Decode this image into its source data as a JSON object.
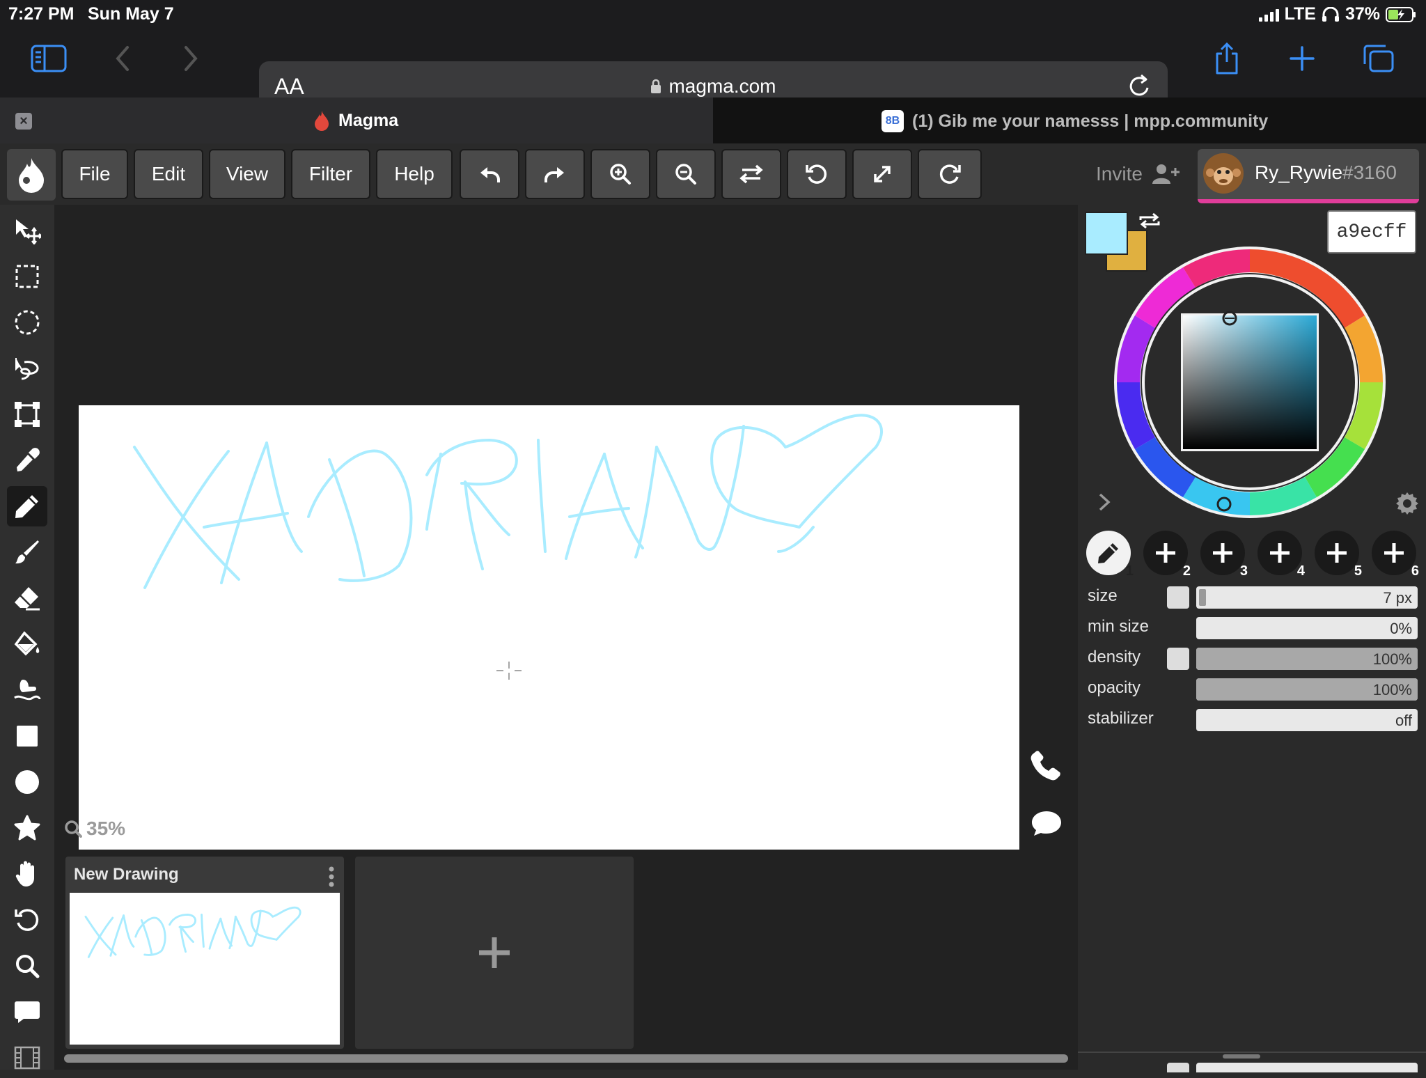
{
  "status": {
    "time": "7:27 PM",
    "date": "Sun May 7",
    "network": "LTE",
    "battery": "37%"
  },
  "browser": {
    "aa_label": "AA",
    "url": "magma.com"
  },
  "tabs": [
    {
      "title": "Magma",
      "active": true
    },
    {
      "title": "(1) Gib me your namesss | mpp.community",
      "active": false,
      "icon_text": "8B"
    }
  ],
  "menu": {
    "file": "File",
    "edit": "Edit",
    "view": "View",
    "filter": "Filter",
    "help": "Help"
  },
  "toolbar_icons": [
    "undo-icon",
    "redo-icon",
    "zoom-in-icon",
    "zoom-out-icon",
    "flip-icon",
    "rotate-left-icon",
    "fullscreen-icon",
    "rotate-right-icon"
  ],
  "invite_label": "Invite",
  "user": {
    "name": "Ry_Rywie",
    "tag": "#3160",
    "accent": "#e03d9a"
  },
  "left_tools": [
    "move-icon",
    "rect-select-icon",
    "ellipse-select-icon",
    "lasso-icon",
    "transform-icon",
    "eyedropper-icon",
    "pencil-icon",
    "brush-icon",
    "eraser-icon",
    "paint-bucket-icon",
    "smudge-icon",
    "rectangle-icon",
    "circle-icon",
    "shape-icon",
    "hand-icon",
    "rotate-view-icon",
    "magnify-icon",
    "comment-icon",
    "film-icon"
  ],
  "active_tool": "pencil-icon",
  "canvas": {
    "zoom": "35%",
    "drawing_text": "XADRIAN",
    "stroke_color": "#a9ecff"
  },
  "documents": [
    {
      "title": "New Drawing"
    }
  ],
  "color": {
    "primary": "#a9ecff",
    "secondary": "#e0b040",
    "hex": "a9ecff"
  },
  "brush_slots": [
    "1",
    "2",
    "3",
    "4",
    "5",
    "6"
  ],
  "brush_props": [
    {
      "label": "size",
      "value": "7 px",
      "fill": 0.0,
      "checkbox": true
    },
    {
      "label": "min size",
      "value": "0%",
      "fill": 0.0,
      "checkbox": false
    },
    {
      "label": "density",
      "value": "100%",
      "fill": 1.0,
      "checkbox": true
    },
    {
      "label": "opacity",
      "value": "100%",
      "fill": 1.0,
      "checkbox": false
    },
    {
      "label": "stabilizer",
      "value": "off",
      "fill": 0.0,
      "checkbox": false
    }
  ]
}
